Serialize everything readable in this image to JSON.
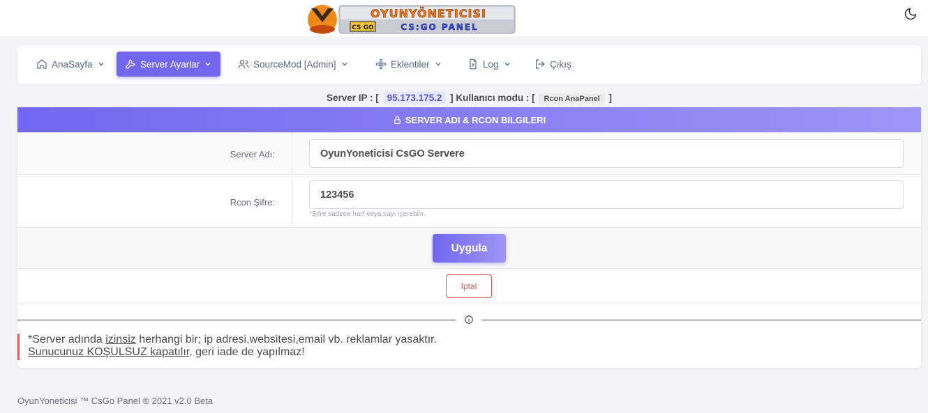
{
  "header": {
    "logo": {
      "line1": "OYUNYÖNETICISI",
      "line2": "CS:GO PANEL",
      "badge": "CS GO"
    },
    "theme_icon": "moon-icon"
  },
  "nav": {
    "items": [
      {
        "label": "AnaSayfa",
        "icon": "home-icon"
      },
      {
        "label": "Server Ayarlar",
        "icon": "wrench-icon"
      },
      {
        "label": "SourceMod [Admin]",
        "icon": "users-icon"
      },
      {
        "label": "Eklentiler",
        "icon": "puzzle-icon"
      },
      {
        "label": "Log",
        "icon": "file-icon"
      },
      {
        "label": "Çıkış",
        "icon": "logout-icon"
      }
    ]
  },
  "server_info": {
    "ip_prefix": "Server IP : [",
    "ip": "95.173.175.2",
    "mode_prefix": "] Kullanıcı modu : [",
    "mode": "Rcon AnaPanel",
    "suffix": "]"
  },
  "form": {
    "title": "SERVER ADI & RCON BILGILERI",
    "server_name_label": "Server Adı:",
    "server_name_value": "OyunYoneticisi CsGO Servere",
    "rcon_label": "Rcon Şifre:",
    "rcon_value": "123456",
    "rcon_hint": "*Şifre sadece harf veya sayı içerebilir.",
    "apply_label": "Uygula",
    "cancel_label": "Iptal"
  },
  "warning": {
    "line1_a": "*Server adında ",
    "line1_b": "izinsiz",
    "line1_c": " herhangi bir; ip adresi,websitesi,email vb. reklamlar yasaktır.",
    "line2_a": "Sunucunuz KOŞULSUZ kapatılır",
    "line2_b": ", geri iade de yapılmaz!"
  },
  "footer": {
    "text": "OyunYoneticisi ™ CsGo Panel ® 2021 v2.0 Beta"
  },
  "colors": {
    "accent": "#7367f0",
    "danger": "#ea5455"
  }
}
